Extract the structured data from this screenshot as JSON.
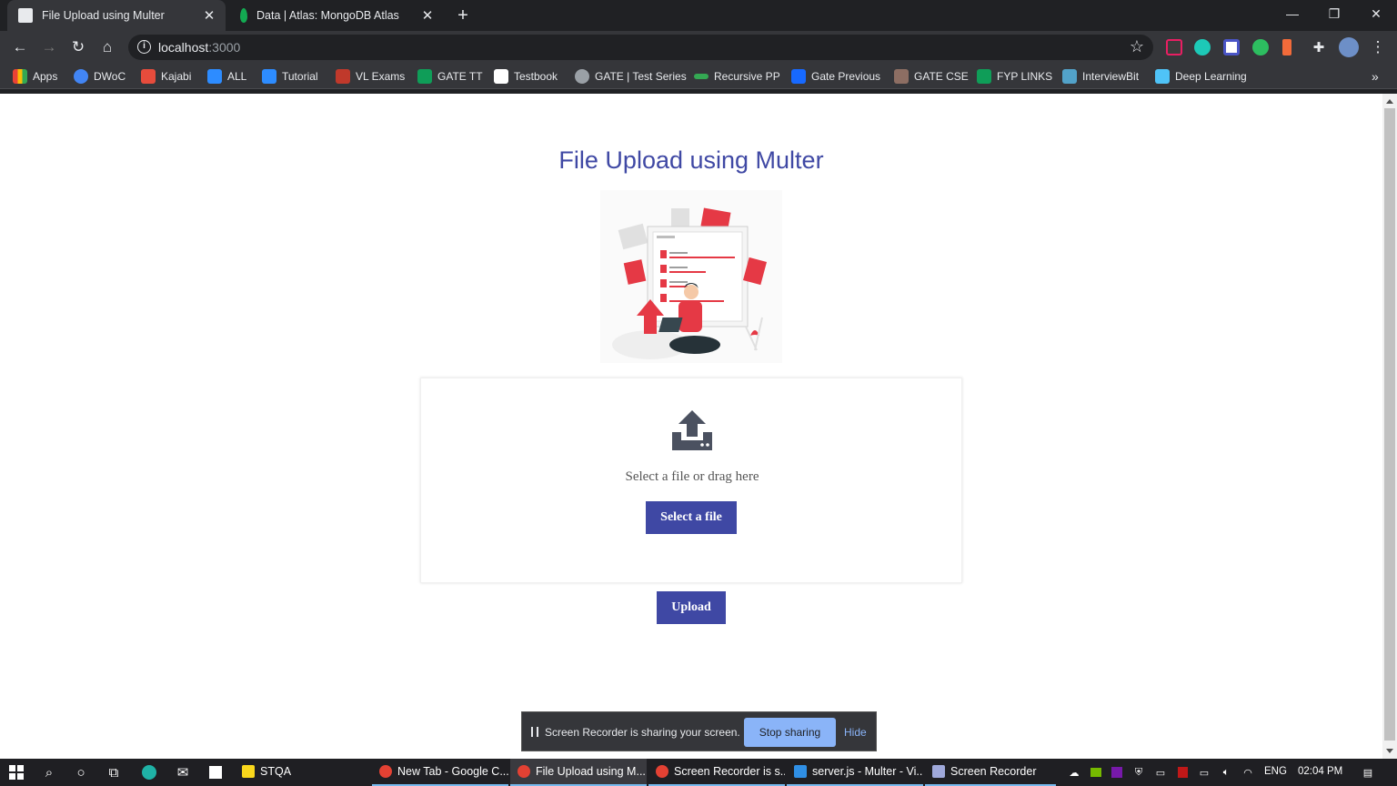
{
  "browser": {
    "tabs": [
      {
        "title": "File Upload using Multer",
        "active": true,
        "favicon_color": "#e8eaed"
      },
      {
        "title": "Data | Atlas: MongoDB Atlas",
        "active": false,
        "favicon_color": "#13aa52"
      }
    ],
    "new_tab": "+",
    "window_controls": {
      "minimize": "—",
      "maximize": "❐",
      "close": "✕"
    },
    "address": {
      "host": "localhost",
      "port": ":3000"
    },
    "bookmarks": [
      {
        "label": "Apps",
        "color": "#ea4335"
      },
      {
        "label": "DWoC",
        "color": "#4285f4"
      },
      {
        "label": "Kajabi",
        "color": "#e74c3c"
      },
      {
        "label": "ALL",
        "color": "#2d8cff"
      },
      {
        "label": "Tutorial",
        "color": "#2d8cff"
      },
      {
        "label": "VL Exams",
        "color": "#c0392b"
      },
      {
        "label": "GATE TT",
        "color": "#0f9d58"
      },
      {
        "label": "Testbook",
        "color": "#ffffff"
      },
      {
        "label": "GATE | Test Series",
        "color": "#9aa0a6"
      },
      {
        "label": "Recursive PP",
        "color": "#34a853"
      },
      {
        "label": "Gate Previous",
        "color": "#1769ff"
      },
      {
        "label": "GATE CSE",
        "color": "#8d6e63"
      },
      {
        "label": "FYP LINKS",
        "color": "#0f9d58"
      },
      {
        "label": "InterviewBit",
        "color": "#52a2c9"
      },
      {
        "label": "Deep Learning",
        "color": "#4fc3f7"
      }
    ],
    "bookmarks_more": "»"
  },
  "page": {
    "title": "File Upload using Multer",
    "drop_text": "Select a file or drag here",
    "select_button": "Select a file",
    "upload_button": "Upload",
    "accent": "#3f48a4"
  },
  "share_bar": {
    "message": "Screen Recorder is sharing your screen.",
    "stop": "Stop sharing",
    "hide": "Hide"
  },
  "taskbar": {
    "apps": [
      {
        "label": "STQA",
        "active": false,
        "color": "#f9d71c"
      },
      {
        "label": "New Tab - Google C...",
        "active": false,
        "color": "#e34133"
      },
      {
        "label": "File Upload using M...",
        "active": true,
        "color": "#e34133"
      },
      {
        "label": "Screen Recorder is s...",
        "active": false,
        "color": "#e34133"
      },
      {
        "label": "server.js - Multer - Vi...",
        "active": false,
        "color": "#2f8fe5"
      },
      {
        "label": "Screen Recorder",
        "active": false,
        "color": "#9fa8da"
      }
    ],
    "language": "ENG",
    "time": "02:04 PM"
  }
}
